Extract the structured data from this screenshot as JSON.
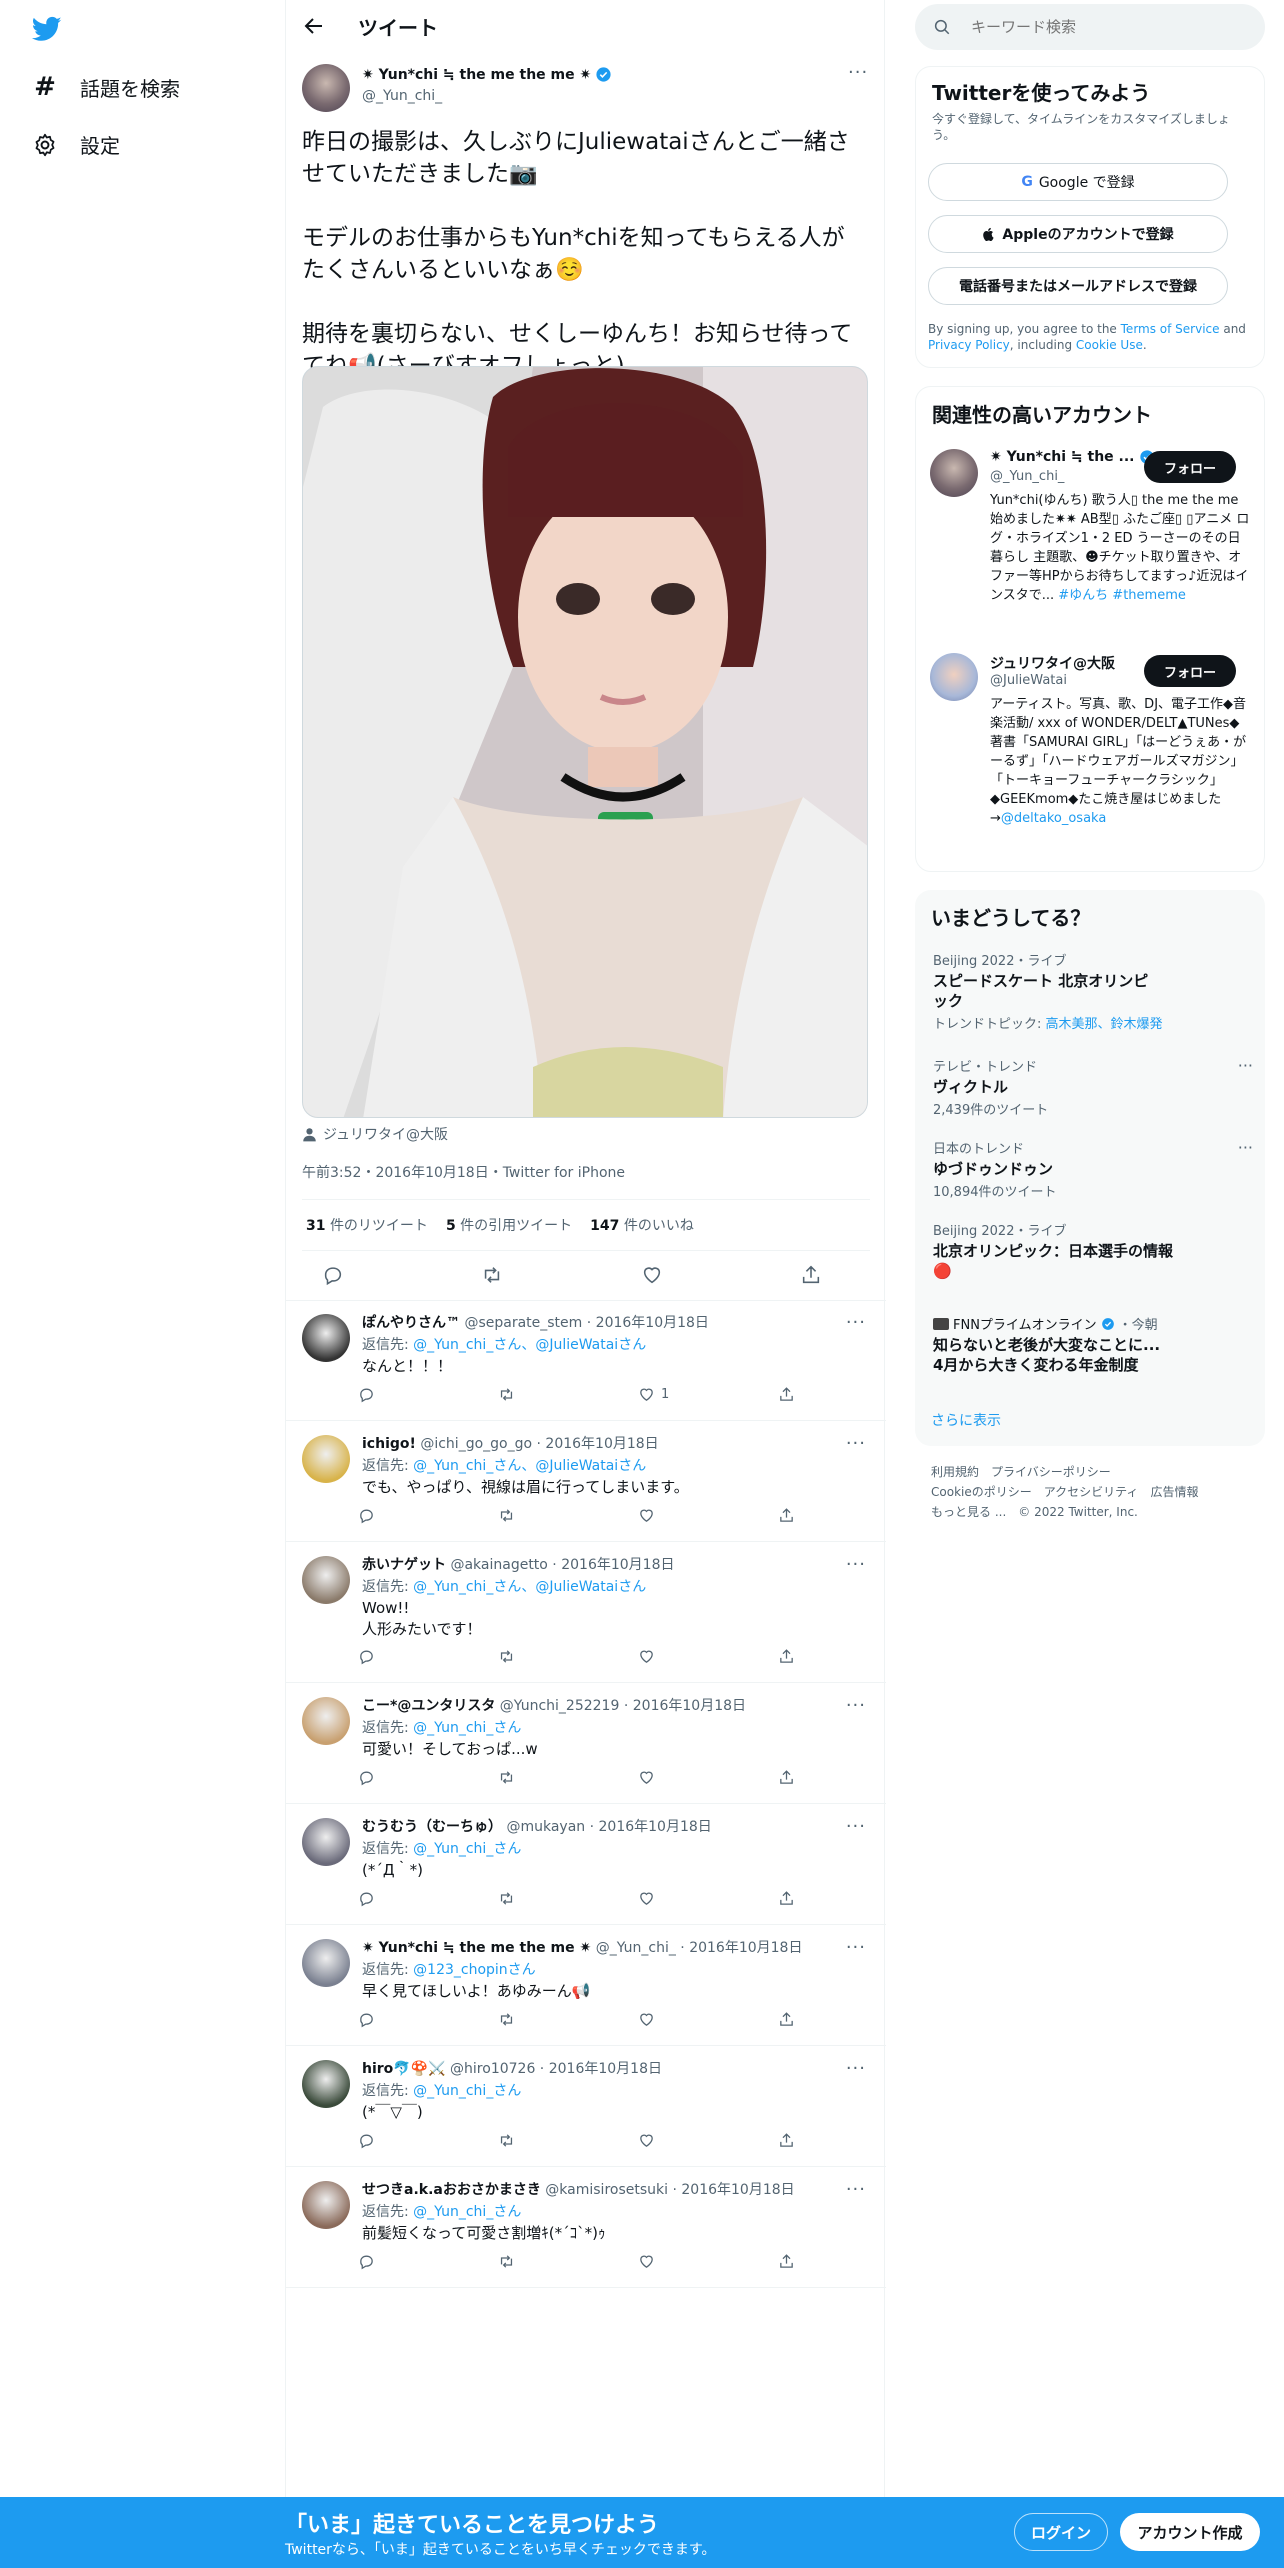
{
  "nav": {
    "explore": "話題を検索",
    "settings": "設定"
  },
  "header": {
    "title": "ツイート"
  },
  "tweet": {
    "author_name": "✷ Yun*chi ≒ the me the me ✷",
    "author_handle": "@_Yun_chi_",
    "paragraph1": "昨日の撮影は、久しぶりにJuliewataiさんとご一緒させていただきました📷",
    "paragraph2": "モデルのお仕事からもYun*chiを知ってもらえる人がたくさんいるといいなぁ☺️",
    "paragraph3": "期待を裏切らない、せくしーゆんち！お知らせ待っててね📢(さーびすオフしょっと)",
    "tagged": "ジュリワタイ@大阪",
    "meta": "午前3:52・2016年10月18日・Twitter for iPhone",
    "retweets_count": "31",
    "retweets_label": "件のリツイート",
    "quotes_count": "5",
    "quotes_label": "件の引用ツイート",
    "likes_count": "147",
    "likes_label": "件のいいね"
  },
  "replies": [
    {
      "name": "ぽんやりさん™",
      "handle": "@separate_stem",
      "date": "2016年10月18日",
      "reply_prefix": "返信先: ",
      "reply_to": "@_Yun_chi_さん、@JulieWataiさん",
      "text": "なんと！！！",
      "like_count": "1",
      "color": "#333"
    },
    {
      "name": "ichigo!",
      "handle": "@ichi_go_go_go",
      "date": "2016年10月18日",
      "reply_prefix": "返信先: ",
      "reply_to": "@_Yun_chi_さん、@JulieWataiさん",
      "text": "でも、やっぱり、視線は眉に行ってしまいます。",
      "like_count": "",
      "color": "#d8b34a"
    },
    {
      "name": "赤いナゲット",
      "handle": "@akainagetto",
      "date": "2016年10月18日",
      "reply_prefix": "返信先: ",
      "reply_to": "@_Yun_chi_さん、@JulieWataiさん",
      "text": "Wow!!\n人形みたいです！",
      "like_count": "",
      "color": "#8a7a6a"
    },
    {
      "name": "こー*@ユンタリスタ",
      "handle": "@Yunchi_252219",
      "date": "2016年10月18日",
      "reply_prefix": "返信先: ",
      "reply_to": "@_Yun_chi_さん",
      "text": "可愛い！そしておっぱ...w",
      "like_count": "",
      "color": "#c8a070"
    },
    {
      "name": "むうむう（むーちゅ）",
      "handle": "@mukayan",
      "date": "2016年10月18日",
      "reply_prefix": "返信先: ",
      "reply_to": "@_Yun_chi_さん",
      "text": "(*´Д｀*)",
      "like_count": "",
      "color": "#6a6a7a"
    },
    {
      "name": "✷ Yun*chi ≒ the me the me ✷",
      "handle": "@_Yun_chi_",
      "date": "2016年10月18日",
      "reply_prefix": "返信先: ",
      "reply_to": "@123_chopinさん",
      "text": "早く見てほしいよ！あゆみーん📢",
      "like_count": "",
      "color": "#7a8090"
    },
    {
      "name": "hiro🐬🍄⚔️",
      "handle": "@hiro10726",
      "date": "2016年10月18日",
      "reply_prefix": "返信先: ",
      "reply_to": "@_Yun_chi_さん",
      "text": "(*￣▽￣)",
      "like_count": "",
      "color": "#3a4a3a"
    },
    {
      "name": "せつきa.k.aおおさかまさき",
      "handle": "@kamisirosetsuki",
      "date": "2016年10月18日",
      "reply_prefix": "返信先: ",
      "reply_to": "@_Yun_chi_さん",
      "text": "前髪短くなって可愛さ割増ｷ(*´ｺ`*)ｩ",
      "like_count": "",
      "color": "#8a6a5a"
    }
  ],
  "search": {
    "placeholder": "キーワード検索"
  },
  "signup": {
    "title": "Twitterを使ってみよう",
    "subtitle": "今すぐ登録して、タイムラインをカスタマイズしましょう。",
    "google_button": "Google で登録",
    "apple_button": "Appleのアカウントで登録",
    "phone_button": "電話番号またはメールアドレスで登録",
    "terms_prefix": "By signing up, you agree to the ",
    "terms_link": "Terms of Service",
    "terms_and": " and ",
    "privacy_link": "Privacy Policy",
    "terms_including": ", including ",
    "cookie_link": "Cookie Use",
    "terms_end": "."
  },
  "related": {
    "title": "関連性の高いアカウント",
    "accounts": [
      {
        "name": "✷ Yun*chi ≒ the ...",
        "handle": "@_Yun_chi_",
        "follow": "フォロー",
        "bio": "Yun*chi(ゆんち) 歌う人▯ the me the me 始めました✷✷ AB型▯ ふたご座▯ ▯アニメ ログ・ホライズン1・2 ED うーさーのその日暮らし 主題歌、☻チケット取り置きや、オファー等HPからお待ちしてますっ♪近況はインスタで...",
        "tags": "#ゆんち #thememe"
      },
      {
        "name": "ジュリワタイ@大阪",
        "handle": "@JulieWatai",
        "follow": "フォロー",
        "bio": "アーティスト。写真、歌、DJ、電子工作◆音楽活動/ xxx of WONDER/DELT▲TUNes◆著書「SAMURAI GIRL」「はーどうぇあ・がーるず」「ハードウェアガールズマガジン」「トーキョーフューチャークラシック」◆GEEKmom◆たこ焼き屋はじめました→",
        "tags": "@deltako_osaka"
      }
    ]
  },
  "trends": {
    "title": "いまどうしてる？",
    "items": [
      {
        "category": "Beijing 2022・ライブ",
        "name": "スピードスケート 北京オリンピック",
        "extra_prefix": "トレンドトピック: ",
        "extra_links": "高木美那、鈴木爆発",
        "count": ""
      },
      {
        "category": "テレビ・トレンド",
        "name": "ヴィクトル",
        "count": "2,439件のツイート"
      },
      {
        "category": "日本のトレンド",
        "name": "ゆづドゥンドゥン",
        "count": "10,894件のツイート"
      },
      {
        "category": "Beijing 2022・ライブ",
        "name": "北京オリンピック：日本選手の情報🔴",
        "count": ""
      },
      {
        "category": "FNNプライムオンライン",
        "time": "・今朝",
        "name": "知らないと老後が大変なことに... 4月から大きく変わる年金制度",
        "count": ""
      }
    ],
    "show_more": "さらに表示"
  },
  "footer": {
    "terms": "利用規約",
    "privacy": "プライバシーポリシー",
    "cookie": "Cookieのポリシー",
    "accessibility": "アクセシビリティ",
    "ads": "広告情報",
    "more": "もっと見る ...",
    "copyright": "© 2022 Twitter, Inc."
  },
  "banner": {
    "title": "「いま」起きていることを見つけよう",
    "subtitle": "Twitterなら、「いま」起きていることをいち早くチェックできます。",
    "login": "ログイン",
    "signup": "アカウント作成"
  },
  "colors": {
    "brand": "#1d9bf0",
    "text": "#0f1419",
    "muted": "#536471"
  }
}
